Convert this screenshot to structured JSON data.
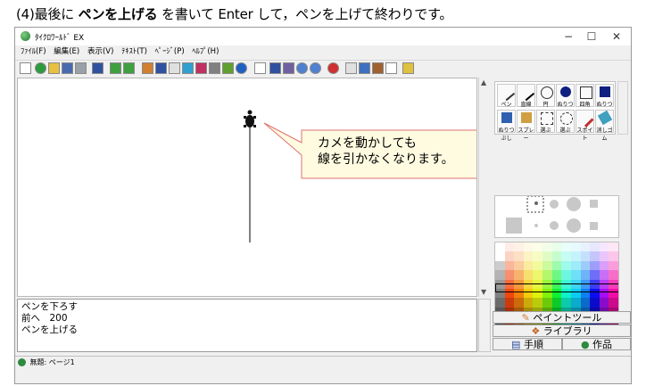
{
  "caption": {
    "prefix": "(4)最後に",
    "bold": "ペンを上げる",
    "suffix": "を書いて Enter して，ペンを上げて終わりです。"
  },
  "window": {
    "title": "ﾀｲｸﾛﾜｰﾙﾄﾞ EX",
    "minimize": "−",
    "maximize": "☐",
    "close": "✕"
  },
  "menu": [
    "ﾌｧｲﾙ(F)",
    "編集(E)",
    "表示(V)",
    "ﾃｷｽﾄ(T)",
    "ﾍﾟｰｼﾞ(P)",
    "ﾍﾙﾌﾟ(H)"
  ],
  "callout": {
    "line1": "カメを動かしても",
    "line2": "線を引かなくなります。"
  },
  "commands": [
    "ペンを下ろす",
    "前へ　200",
    "ペンを上げる"
  ],
  "tools": [
    "ペン",
    "直線",
    "円",
    "ぬりつぶし",
    "四角",
    "ぬりつぶし",
    "ぬりつぶし",
    "スプレー",
    "選ぶ",
    "選ぶ",
    "スポイト",
    "消しゴム"
  ],
  "tabs": {
    "paint": "ペイントツール",
    "library": "ライブラリ",
    "procedure": "手順",
    "works": "作品"
  },
  "status": {
    "page": "無題: ページ1"
  },
  "colors": {
    "accent_bubble": "#fffbe0",
    "bubble_border": "#e07070",
    "turtle": "#111111"
  }
}
